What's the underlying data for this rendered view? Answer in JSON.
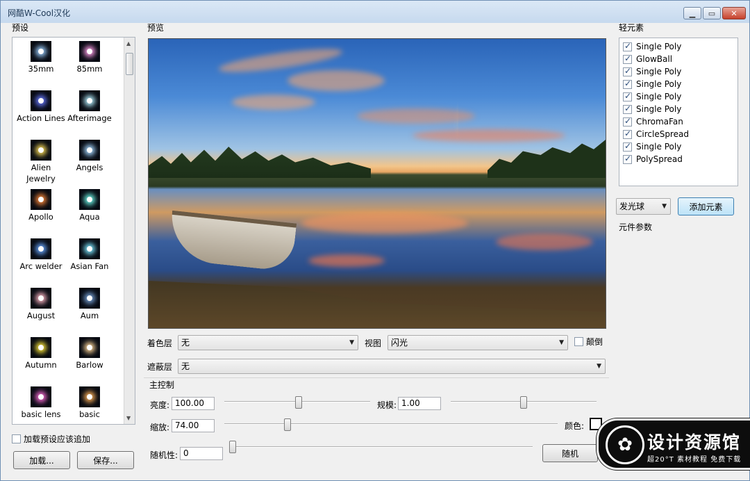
{
  "window": {
    "title": "网酷W-Cool汉化",
    "min_icon": "minimize-icon",
    "max_icon": "maximize-icon",
    "close_icon": "close-icon"
  },
  "presets": {
    "section_label": "预设",
    "items": [
      {
        "label": "35mm",
        "color": "#9ed0ff"
      },
      {
        "label": "85mm",
        "color": "#ff9ee8"
      },
      {
        "label": "Action Lines",
        "color": "#6a7bff"
      },
      {
        "label": "Afterimage",
        "color": "#b7f0ff"
      },
      {
        "label": "Alien Jewelry",
        "color": "#ffe15a"
      },
      {
        "label": "Angels",
        "color": "#a7d8ff"
      },
      {
        "label": "Apollo",
        "color": "#ff8a3a"
      },
      {
        "label": "Aqua",
        "color": "#6ff7e8"
      },
      {
        "label": "Arc welder",
        "color": "#6aa8ff"
      },
      {
        "label": "Asian Fan",
        "color": "#7de7ff"
      },
      {
        "label": "August",
        "color": "#ffb7c6"
      },
      {
        "label": "Aum",
        "color": "#7aa4d8"
      },
      {
        "label": "Autumn",
        "color": "#ffea3a"
      },
      {
        "label": "Barlow",
        "color": "#ffd79a"
      },
      {
        "label": "basic lens",
        "color": "#ff6fd8"
      },
      {
        "label": "basic",
        "color": "#ffb25a"
      }
    ],
    "append_checkbox": "加载预设应该追加",
    "load_button": "加载...",
    "save_button": "保存..."
  },
  "preview": {
    "section_label": "预览"
  },
  "controls": {
    "color_layer_label": "着色层",
    "color_layer_value": "无",
    "view_label": "视图",
    "view_value": "闪光",
    "invert_label": "颠倒",
    "mask_layer_label": "遮蔽层",
    "mask_layer_value": "无",
    "main_group_label": "主控制",
    "brightness_label": "亮度:",
    "brightness_value": "100.00",
    "brightness_level": 0.51,
    "scale_label": "规模:",
    "scale_value": "1.00",
    "scale_level": 0.5,
    "zoom_label": "缩放:",
    "zoom_value": "74.00",
    "zoom_level": 0.19,
    "color_label": "颜色:",
    "random_label": "随机性:",
    "random_value": "0",
    "random_level": 0.0,
    "random_button": "随机"
  },
  "elements": {
    "section_label": "轻元素",
    "items": [
      {
        "label": "Single Poly",
        "checked": true
      },
      {
        "label": "GlowBall",
        "checked": true
      },
      {
        "label": "Single Poly",
        "checked": true
      },
      {
        "label": "Single Poly",
        "checked": true
      },
      {
        "label": "Single Poly",
        "checked": true
      },
      {
        "label": "Single Poly",
        "checked": true
      },
      {
        "label": "ChromaFan",
        "checked": true
      },
      {
        "label": "CircleSpread",
        "checked": true
      },
      {
        "label": "Single Poly",
        "checked": true
      },
      {
        "label": "PolySpread",
        "checked": true
      }
    ],
    "type_combo": "发光球",
    "add_button": "添加元素",
    "params_label": "元件参数"
  },
  "watermark": {
    "title": "设计资源馆",
    "subtitle": "超20°T 素材教程 免费下载",
    "icon": "wechat-icon"
  }
}
